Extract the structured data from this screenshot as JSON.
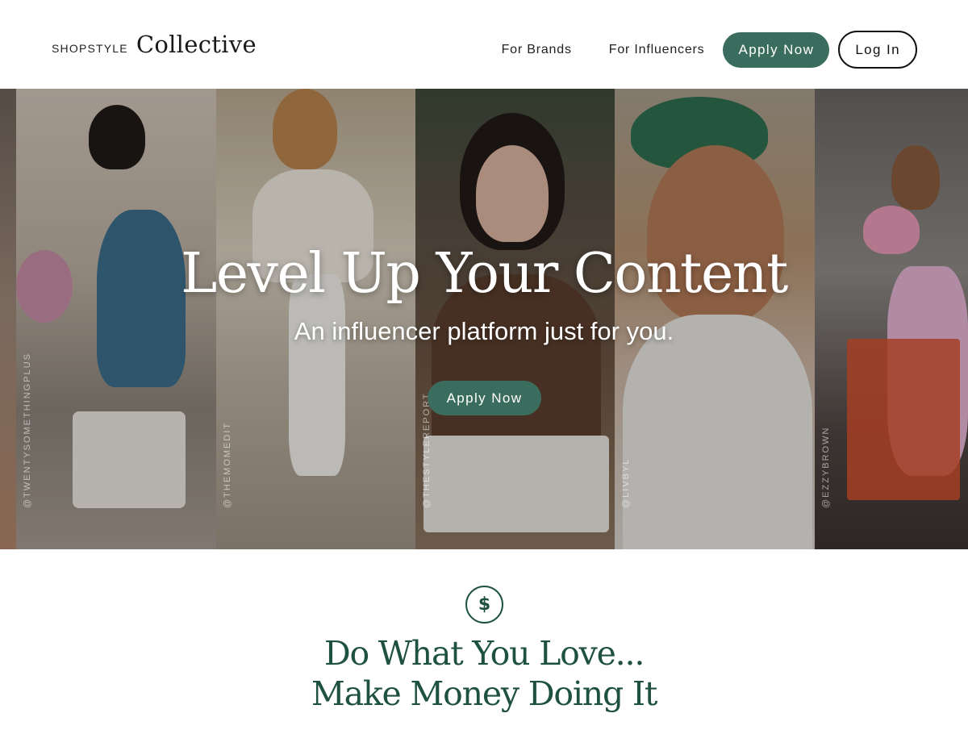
{
  "header": {
    "logo_small": "SHOPSTYLE",
    "logo_large": "Collective",
    "nav": {
      "brands": "For Brands",
      "influencers": "For Influencers",
      "apply": "Apply Now",
      "login": "Log In"
    }
  },
  "hero": {
    "title": "Level Up Your Content",
    "subtitle": "An influencer platform just for you.",
    "cta": "Apply Now",
    "handles": [
      "@TWENTYSOMETHINGPLUS",
      "@THEMOMEDIT",
      "@THESTYLEREPORT",
      "@LIVBYL",
      "@EZZYBROWN"
    ]
  },
  "feature": {
    "icon": "dollar-icon",
    "icon_glyph": "$",
    "line1": "Do What You Love...",
    "line2": "Make Money Doing It"
  },
  "colors": {
    "accent": "#3b6d5e",
    "heading": "#1e5140"
  }
}
